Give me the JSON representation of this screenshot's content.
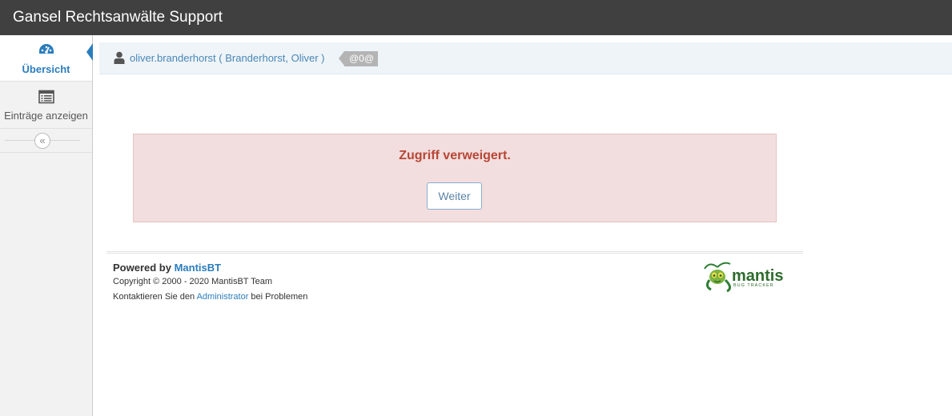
{
  "app": {
    "title": "Gansel Rechtsanwälte Support"
  },
  "sidebar": {
    "items": [
      {
        "label": "Übersicht",
        "icon": "dashboard-icon",
        "active": true
      },
      {
        "label": "Einträge anzeigen",
        "icon": "list-icon",
        "active": false
      }
    ],
    "collapse_glyph": "«"
  },
  "breadcrumbs": {
    "user_link": "oliver.branderhorst ( Branderhorst, Oliver )",
    "tag": "@0@"
  },
  "alert": {
    "message": "Zugriff verweigert.",
    "button_label": "Weiter"
  },
  "footer": {
    "powered_prefix": "Powered by ",
    "powered_link": "MantisBT",
    "copyright": "Copyright © 2000 - 2020 MantisBT Team",
    "contact_prefix": "Kontaktieren Sie den ",
    "contact_link": "Administrator",
    "contact_suffix": " bei Problemen",
    "logo_text": "mantis",
    "logo_subtext": "BUG TRACKER"
  },
  "colors": {
    "navbar": "#404040",
    "accent": "#2b7dbc",
    "alert_bg": "#f2dede",
    "alert_text": "#b74635"
  }
}
